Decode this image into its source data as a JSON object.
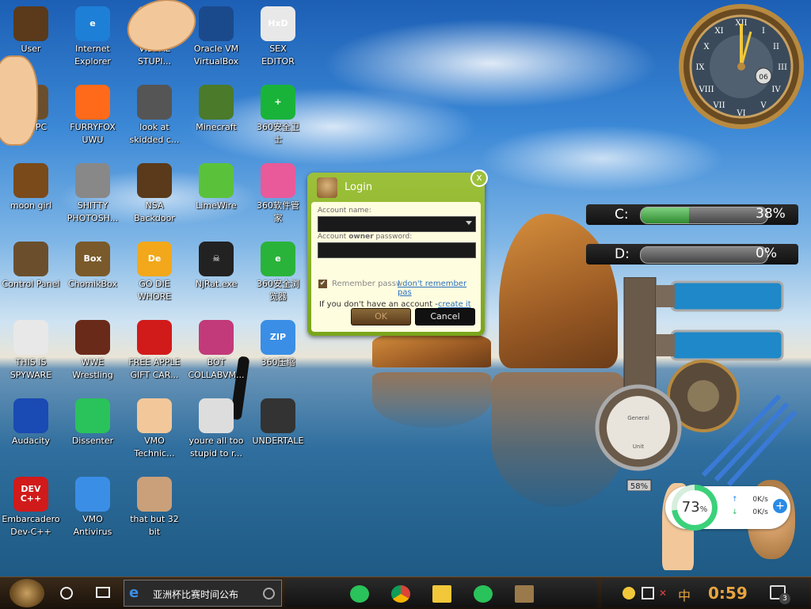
{
  "desktop": {
    "icons": [
      {
        "label": "User",
        "glyph": "",
        "color": "#5a3a1a"
      },
      {
        "label": "Internet\nExplorer",
        "glyph": "e",
        "color": "#1e7fd6"
      },
      {
        "label": "VISUAL\nSTUPI...",
        "glyph": "",
        "color": "#f2c89a"
      },
      {
        "label": "Oracle VM\nVirtualBox",
        "glyph": "",
        "color": "#1b4a8c"
      },
      {
        "label": "SEX\nEDITOR",
        "glyph": "HxD",
        "color": "#e8e8e8"
      },
      {
        "label": "This PC",
        "glyph": "",
        "color": "#6b4f2c"
      },
      {
        "label": "FURRYFOX\nUWU",
        "glyph": "",
        "color": "#ff6a1a"
      },
      {
        "label": "look at\nskidded c...",
        "glyph": "",
        "color": "#555555"
      },
      {
        "label": "Minecraft",
        "glyph": "",
        "color": "#4a7a2a"
      },
      {
        "label": "360安全卫\n士",
        "glyph": "+",
        "color": "#1ab33a"
      },
      {
        "label": "moon girl",
        "glyph": "",
        "color": "#7a4a1a"
      },
      {
        "label": "SHITTY\nPHOTOSH...",
        "glyph": "",
        "color": "#888888"
      },
      {
        "label": "NSA\nBackdoor",
        "glyph": "",
        "color": "#5a3a1a"
      },
      {
        "label": "LimeWire",
        "glyph": "",
        "color": "#5ac23a"
      },
      {
        "label": "360软件管\n家",
        "glyph": "",
        "color": "#e85a9a"
      },
      {
        "label": "Control Panel",
        "glyph": "",
        "color": "#6b4f2c"
      },
      {
        "label": "ChomikBox",
        "glyph": "Box",
        "color": "#7a5a2a"
      },
      {
        "label": "GO DIE\nWHORE",
        "glyph": "De",
        "color": "#f2a81a"
      },
      {
        "label": "NjRat.exe",
        "glyph": "☠",
        "color": "#222222"
      },
      {
        "label": "360安全浏\n览器",
        "glyph": "e",
        "color": "#2ab33a"
      },
      {
        "label": "THIS IS\nSPYWARE",
        "glyph": "",
        "color": "#e8e8e8"
      },
      {
        "label": "WWE\nWrestling",
        "glyph": "",
        "color": "#6a2a1a"
      },
      {
        "label": "FREE APPLE\nGIFT CAR...",
        "glyph": "",
        "color": "#d11a1a"
      },
      {
        "label": "BOT\nCOLLABVM...",
        "glyph": "",
        "color": "#c23a7a"
      },
      {
        "label": "360压缩",
        "glyph": "ZIP",
        "color": "#3a8ee6"
      },
      {
        "label": "Audacity",
        "glyph": "",
        "color": "#1a4ab3"
      },
      {
        "label": "Dissenter",
        "glyph": "",
        "color": "#2ac25a"
      },
      {
        "label": "VMO\nTechnic...",
        "glyph": "",
        "color": "#f2c89a"
      },
      {
        "label": "youre all too\nstupid to r...",
        "glyph": "",
        "color": "#dddddd"
      },
      {
        "label": "UNDERTALE",
        "glyph": "",
        "color": "#333333"
      },
      {
        "label": "Embarcadero\nDev-C++",
        "glyph": "DEV\nC++",
        "color": "#d11a1a"
      },
      {
        "label": "VMO\nAntivirus",
        "glyph": "",
        "color": "#3a8ee6"
      },
      {
        "label": "that but 32\nbit",
        "glyph": "",
        "color": "#c9a07a"
      }
    ]
  },
  "login_dialog": {
    "title": "Login",
    "close": "x",
    "account_name_label": "Account name:",
    "password_label_prefix": "Account ",
    "password_label_bold": "owner",
    "password_label_suffix": " password:",
    "remember_label": "Remember passw",
    "forgot_link": "I don't remember pas",
    "no_account_text": "If you don't have an account - ",
    "create_link": "create it",
    "ok_label": "OK",
    "cancel_label": "Cancel"
  },
  "gadgets": {
    "clock_number": "06",
    "drives": [
      {
        "letter": "C:",
        "percent_text": "38%",
        "percent": 38
      },
      {
        "letter": "D:",
        "percent_text": "0%",
        "percent": 0
      }
    ],
    "gauge_text": "58%",
    "network": {
      "ring_value": "73",
      "ring_unit": "%",
      "ring_percent": 73,
      "upload": "0K/s",
      "download": "0K/s"
    }
  },
  "taskbar": {
    "search_text": "亚洲杯比赛时间公布",
    "clock": "0:59",
    "ime": "中",
    "notification_count": "3",
    "apps": [
      "dissenter",
      "chrome",
      "file-explorer",
      "360-browser",
      "chomikbox"
    ]
  }
}
